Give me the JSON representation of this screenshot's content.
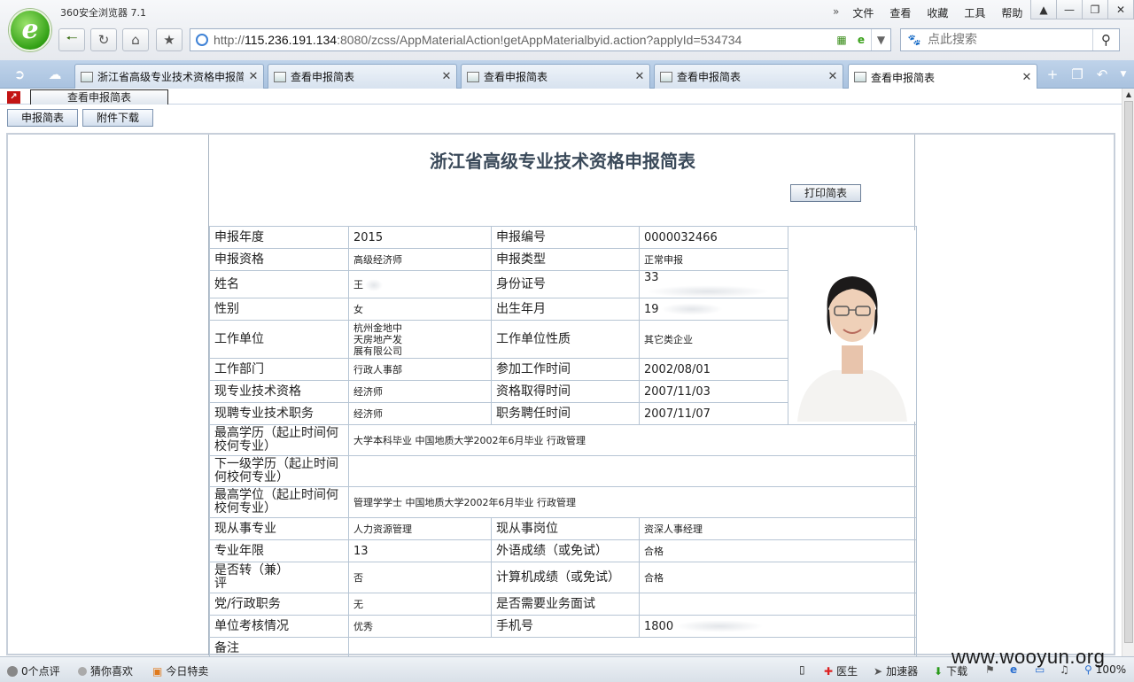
{
  "browser": {
    "title": "360安全浏览器 7.1",
    "logo_letter": "e",
    "menu": [
      "文件",
      "查看",
      "收藏",
      "工具",
      "帮助"
    ],
    "address": {
      "scheme": "http://",
      "host": "115.236.191.134",
      "rest": ":8080/zcss/AppMaterialAction!getAppMaterialbyid.action?applyId=534734"
    },
    "search": {
      "placeholder": "点此搜索"
    },
    "tabs": [
      {
        "label": "浙江省高级专业技术资格申报简表",
        "active": false
      },
      {
        "label": "查看申报简表",
        "active": false
      },
      {
        "label": "查看申报简表",
        "active": false
      },
      {
        "label": "查看申报简表",
        "active": false
      },
      {
        "label": "查看申报简表",
        "active": true
      }
    ]
  },
  "page": {
    "inner_tab": "查看申报简表",
    "buttons": {
      "summary": "申报简表",
      "download": "附件下载"
    },
    "form_title": "浙江省高级专业技术资格申报简表",
    "print_label": "打印简表",
    "fields": {
      "year_label": "申报年度",
      "year": "2015",
      "no_label": "申报编号",
      "no": "0000032466",
      "qual_label": "申报资格",
      "qual": "高级经济师",
      "type_label": "申报类型",
      "type": "正常申报",
      "name_label": "姓名",
      "name": "王",
      "id_label": "身份证号",
      "id": "33",
      "sex_label": "性别",
      "sex": "女",
      "birth_label": "出生年月",
      "birth": "19",
      "org_label": "工作单位",
      "org": "杭州金地中天房地产发展有限公司",
      "org_type_label": "工作单位性质",
      "org_type": "其它类企业",
      "dept_label": "工作部门",
      "dept": "行政人事部",
      "start_label": "参加工作时间",
      "start": "2002/08/01",
      "cur_qual_label": "现专业技术资格",
      "cur_qual": "经济师",
      "qual_date_label": "资格取得时间",
      "qual_date": "2007/11/03",
      "cur_post_label": "现聘专业技术职务",
      "cur_post": "经济师",
      "post_date_label": "职务聘任时间",
      "post_date": "2007/11/07",
      "edu_label": "最高学历（起止时间何校何专业）",
      "edu": "大学本科毕业  中国地质大学2002年6月毕业  行政管理",
      "edu2_label": "下一级学历（起止时间何校何专业）",
      "edu2": "",
      "degree_label": "最高学位（起止时间何校何专业）",
      "degree": "管理学学士  中国地质大学2002年6月毕业  行政管理",
      "major_label": "现从事专业",
      "major": "人力资源管理",
      "pos_label": "现从事岗位",
      "pos": "资深人事经理",
      "years_label": "专业年限",
      "years": "13",
      "lang_label": "外语成绩（或免试）",
      "lang": "合格",
      "transfer_label": "是否转（兼）评",
      "transfer": "否",
      "comp_label": "计算机成绩（或免试）",
      "comp": "合格",
      "party_label": "党/行政职务",
      "party": "无",
      "interview_label": "是否需要业务面试",
      "interview": "",
      "assess_label": "单位考核情况",
      "assess": "优秀",
      "phone_label": "手机号",
      "phone": "1800",
      "remark_label": "备注",
      "remark": ""
    }
  },
  "statusbar": {
    "reviews": "0个点评",
    "guess": "猜你喜欢",
    "today": "今日特卖",
    "doctor": "医生",
    "accel": "加速器",
    "download": "下载",
    "zoom": "100%"
  },
  "watermark": "www.wooyun.org",
  "colors": {
    "tabbar": "#a9c2df",
    "logo_green": "#33a116",
    "title_text": "#3b4a5a"
  }
}
